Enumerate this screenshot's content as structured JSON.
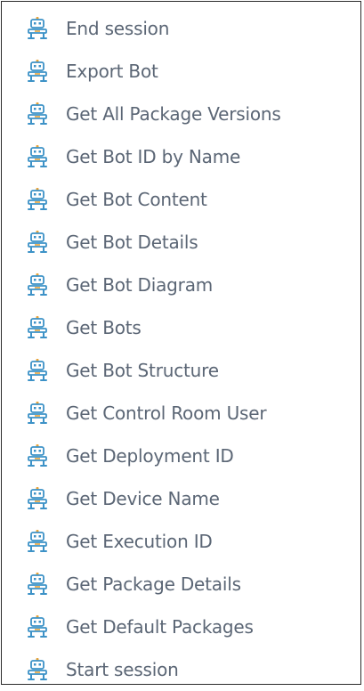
{
  "actions": [
    {
      "label": "End session",
      "icon": "bot-icon"
    },
    {
      "label": "Export Bot",
      "icon": "bot-icon"
    },
    {
      "label": "Get All Package Versions",
      "icon": "bot-icon"
    },
    {
      "label": "Get Bot ID by Name",
      "icon": "bot-icon"
    },
    {
      "label": "Get Bot Content",
      "icon": "bot-icon"
    },
    {
      "label": "Get Bot Details",
      "icon": "bot-icon"
    },
    {
      "label": "Get Bot Diagram",
      "icon": "bot-icon"
    },
    {
      "label": "Get Bots",
      "icon": "bot-icon"
    },
    {
      "label": "Get Bot Structure",
      "icon": "bot-icon"
    },
    {
      "label": "Get Control Room User",
      "icon": "bot-icon"
    },
    {
      "label": "Get Deployment ID",
      "icon": "bot-icon"
    },
    {
      "label": "Get Device Name",
      "icon": "bot-icon"
    },
    {
      "label": "Get Execution ID",
      "icon": "bot-icon"
    },
    {
      "label": "Get Package Details",
      "icon": "bot-icon"
    },
    {
      "label": "Get Default Packages",
      "icon": "bot-icon"
    },
    {
      "label": "Start session",
      "icon": "bot-icon"
    }
  ],
  "colors": {
    "icon_primary": "#3d92c7",
    "icon_accent": "#e6a33a",
    "label_text": "#5b6675",
    "border": "#2b2b2b"
  }
}
